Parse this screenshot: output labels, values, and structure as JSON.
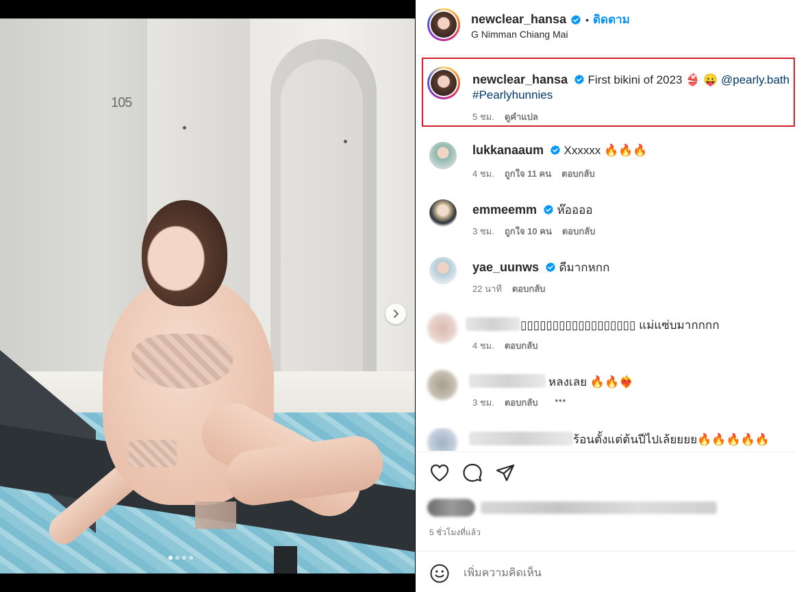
{
  "post": {
    "author": "newclear_hansa",
    "follow_label": "ติดตาม",
    "separator": "•",
    "location": "G Nimman Chiang Mai",
    "photo": {
      "room_number": "105",
      "next_icon": "chevron-right-icon",
      "carousel_dots": 4,
      "active_dot": 1
    }
  },
  "caption": {
    "username": "newclear_hansa",
    "text": "First bikini of 2023 👙 😛 ",
    "mention": "@pearly.bath",
    "hashtag": "#Pearlyhunnies",
    "time": "5 ชม.",
    "translate": "ดูคำแปล"
  },
  "comments": [
    {
      "username": "lukkanaaum",
      "verified": true,
      "text": "Xxxxxx 🔥🔥🔥",
      "time": "4 ชม.",
      "likes": "ถูกใจ 11 คน",
      "reply": "ตอบกลับ"
    },
    {
      "username": "emmeemm",
      "verified": true,
      "text": "ห๊ออออ",
      "time": "3 ชม.",
      "likes": "ถูกใจ 10 คน",
      "reply": "ตอบกลับ"
    },
    {
      "username": "yae_uunws",
      "verified": true,
      "text": "ดีมากหกก",
      "time": "22 นาที",
      "reply": "ตอบกลับ"
    },
    {
      "text": "▯▯▯▯▯▯▯▯▯▯▯▯▯▯▯▯▯▯ แม่แซ่บมากกกก",
      "time": "4 ชม.",
      "reply": "ตอบกลับ"
    },
    {
      "text": "หลงเลย 🔥🔥❤️‍🔥",
      "time": "3 ชม.",
      "reply": "ตอบกลับ",
      "more": "•••"
    },
    {
      "text": "ร้อนตั้งแต่ต้นปีไปเล้ยยยย🔥🔥🔥🔥🔥"
    }
  ],
  "footer": {
    "time_ago": "5 ชั่วโมงที่แล้ว",
    "comment_placeholder": "เพิ่มความคิดเห็น",
    "icons": [
      "heart-icon",
      "comment-icon",
      "share-icon",
      "emoji-icon"
    ]
  },
  "colors": {
    "accent": "#0095f6",
    "highlight": "#d0202a",
    "text": "#262626",
    "muted": "#737373",
    "mention": "#00376b"
  }
}
